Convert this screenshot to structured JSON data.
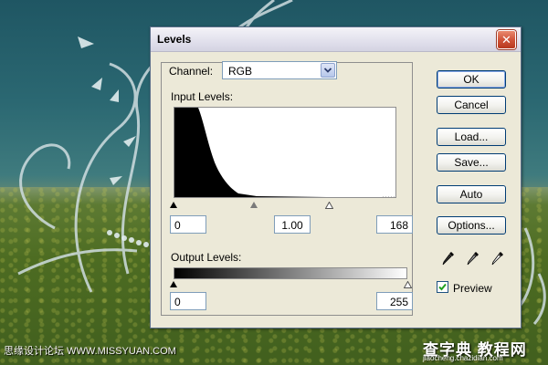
{
  "window": {
    "title": "Levels",
    "close_glyph": "✕"
  },
  "channel": {
    "label": "Channel:",
    "value": "RGB"
  },
  "input_levels": {
    "label": "Input Levels:",
    "black": "0",
    "gamma": "1.00",
    "white": "168"
  },
  "output_levels": {
    "label": "Output Levels:",
    "black": "0",
    "white": "255"
  },
  "buttons": {
    "ok": "OK",
    "cancel": "Cancel",
    "load": "Load...",
    "save": "Save...",
    "auto": "Auto",
    "options": "Options..."
  },
  "preview": {
    "label": "Preview",
    "checked": true
  },
  "watermarks": {
    "left": "思缘设计论坛 WWW.MISSYUAN.COM",
    "right_main": "查字典 教程网",
    "right_sub": "jiaocheng.chazidian.com"
  },
  "colors": {
    "dialog_bg": "#ece9d8",
    "close_button": "#d0553a",
    "field_border": "#7f9db9"
  }
}
